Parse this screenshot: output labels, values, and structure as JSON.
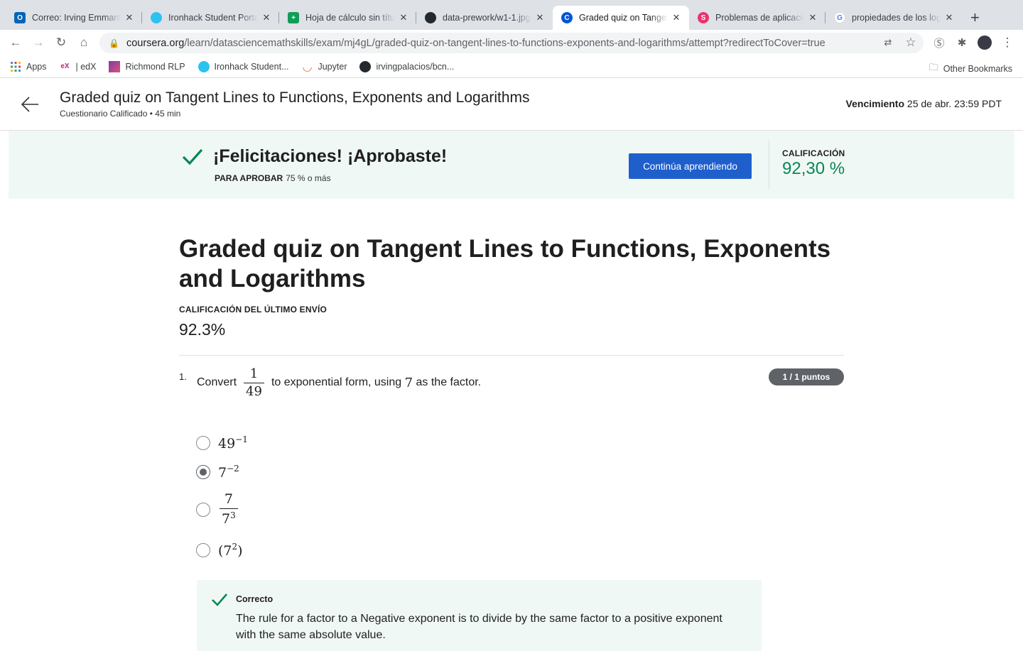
{
  "browser": {
    "tabs": [
      {
        "title": "Correo: Irving Emmanuel",
        "favicon_text": "O",
        "color": "#0364b8"
      },
      {
        "title": "Ironhack Student Portal",
        "favicon_text": "",
        "color": "#2cc2f0"
      },
      {
        "title": "Hoja de cálculo sin título",
        "favicon_text": "+",
        "color": "#0f9d58"
      },
      {
        "title": "data-prework/w1-1.jpg",
        "favicon_text": "",
        "color": "#24292e"
      },
      {
        "title": "Graded quiz on Tangent",
        "favicon_text": "C",
        "color": "#0056d2"
      },
      {
        "title": "Problemas de aplicación",
        "favicon_text": "S",
        "color": "#e8336d"
      },
      {
        "title": "propiedades de los logaritmos",
        "favicon_text": "G",
        "color": "#4285f4"
      }
    ],
    "active_tab": 4,
    "url_domain": "coursera.org",
    "url_path": "/learn/datasciencemathskills/exam/mj4gL/graded-quiz-on-tangent-lines-to-functions-exponents-and-logarithms/attempt?redirectToCover=true",
    "bookmarks": [
      "Apps",
      "| edX",
      "Richmond RLP",
      "Ironhack Student...",
      "Jupyter",
      "irvingpalacios/bcn..."
    ],
    "other_bookmarks": "Other Bookmarks"
  },
  "header": {
    "title": "Graded quiz on Tangent Lines to Functions, Exponents and Logarithms",
    "subtitle": "Cuestionario Calificado • 45 min",
    "due_label": "Vencimiento",
    "due_value": "25 de abr. 23:59 PDT"
  },
  "banner": {
    "message": "¡Felicitaciones! ¡Aprobaste!",
    "pass_label": "PARA APROBAR",
    "pass_value": "75 % o más",
    "continue_button": "Continúa aprendiendo",
    "grade_label": "CALIFICACIÓN",
    "grade_value": "92,30 %"
  },
  "main": {
    "title": "Graded quiz on Tangent Lines to Functions, Exponents and Logarithms",
    "last_grade_label": "CALIFICACIÓN DEL ÚLTIMO ENVÍO",
    "last_grade_value": "92.3%"
  },
  "question": {
    "number": "1.",
    "text_before": "Convert",
    "fraction_num": "1",
    "fraction_den": "49",
    "text_after": "to exponential form, using",
    "factor": "7",
    "text_end": "as the factor.",
    "points": "1 / 1 puntos",
    "options": [
      {
        "base": "49",
        "exp": "−1",
        "selected": false
      },
      {
        "base": "7",
        "exp": "−2",
        "selected": true
      },
      {
        "num": "7",
        "den_base": "7",
        "den_exp": "3",
        "selected": false
      },
      {
        "open": "(",
        "base": "7",
        "exp": "2",
        "close": ")",
        "selected": false
      }
    ],
    "feedback_label": "Correcto",
    "feedback_text": "The rule for  a factor to a Negative exponent is to divide by the same factor to a positive exponent with the same absolute value."
  },
  "colors": {
    "accent_blue": "#1f5fcc",
    "success_green": "#0a8754",
    "banner_bg": "#f0f8f5"
  }
}
